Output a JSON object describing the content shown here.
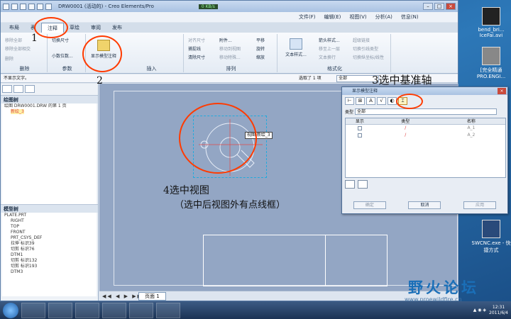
{
  "app": {
    "title": "DRW0001 (活动的) - Creo Elements/Pro",
    "speed": "0 KB/s",
    "menus": [
      "文件(F)",
      "编辑(E)",
      "视图(V)",
      "分析(A)",
      "信息(N)"
    ]
  },
  "tabs": [
    "布局",
    "表",
    "注释",
    "草绘",
    "审阅",
    "发布"
  ],
  "active_tab": "注释",
  "ribbon": {
    "delete_group": {
      "label": "删除",
      "items": [
        "移除全部",
        "移除全部相交",
        "删除"
      ]
    },
    "params_group": {
      "label": "参数",
      "items": [
        "切换尺寸",
        "小数位数..."
      ]
    },
    "show_model_annotation": "显示模型注释",
    "insert_group": {
      "label": "插入"
    },
    "arrange_group": {
      "label": "排列",
      "items": [
        "对齐尺寸",
        "清除尺寸",
        "附件...",
        "移动到视图",
        "移动特殊...",
        "平移",
        "旋转",
        "缩放"
      ]
    },
    "format_group": {
      "label": "格式化",
      "items": [
        "文本样式...",
        "箭头样式...",
        "超级链接",
        "移至上一层",
        "切换引线类型",
        "文本换行",
        "切换纵坐标/线性"
      ]
    },
    "arrange_extra": "捕捉线"
  },
  "cmdline": {
    "message": "不显示文字。",
    "selected": "选取了 1 项",
    "filter": "全部"
  },
  "left_panel": {
    "drawing_tree": {
      "title": "绘图树",
      "items": [
        "绘图 DRW0001.DRW 的第 1 页",
        "新绘_3"
      ]
    },
    "model_tree": {
      "title": "模型树",
      "items": [
        "PLATE.PRT",
        "RIGHT",
        "TOP",
        "FRONT",
        "PRT_CSYS_DEF",
        "拉伸 标识39",
        "切剪 标识76",
        "DTM1",
        "切剪 标识132",
        "切剪 标识193",
        "DTM3"
      ]
    }
  },
  "drawing": {
    "tooltip": "视图 新绘_3"
  },
  "bottom": {
    "page_tab": "页面 1"
  },
  "dialog": {
    "title": "显示模型注释",
    "type_label": "类型",
    "type_value": "全部",
    "columns": [
      "显示",
      "类型",
      "名称"
    ],
    "rows": [
      {
        "name": "A_1"
      },
      {
        "name": "A_2"
      }
    ],
    "buttons": [
      "确定",
      "取消",
      "应用"
    ]
  },
  "annotations": {
    "a1": "1",
    "a2": "2",
    "a3": "3选中基准轴",
    "a4": "4选中视图",
    "a4_sub": "（选中后视图外有点线框）"
  },
  "desktop": {
    "icons": [
      {
        "label": "bend_bri... IceFai.avi"
      },
      {
        "label": "[完全精通 PRO.ENGI..."
      },
      {
        "label": "SWCNC.exe - 快捷方式"
      }
    ]
  },
  "taskbar": {
    "time": "12:31",
    "date": "2011/6/4"
  },
  "watermark": {
    "text": "野火论坛",
    "url": "www.proewildfire.cn"
  },
  "colors": {
    "annotation_ring": "#ff3b00",
    "drawing_bg": "#93a6c4",
    "dialog_active_tab": "#c08b2b"
  }
}
